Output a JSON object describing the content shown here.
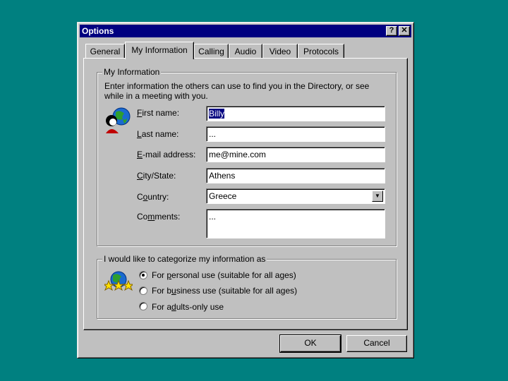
{
  "window": {
    "title": "Options",
    "help_label": "?",
    "close_label": "✕"
  },
  "tabs": [
    {
      "label": "General"
    },
    {
      "label": "My Information",
      "active": true
    },
    {
      "label": "Calling"
    },
    {
      "label": "Audio"
    },
    {
      "label": "Video"
    },
    {
      "label": "Protocols"
    }
  ],
  "info_group": {
    "legend": "My Information",
    "intro_line1": "Enter information the others can use to find you in the Directory, or see",
    "intro_line2": "while in a meeting with you."
  },
  "fields": {
    "first_name": {
      "key": "F",
      "rest": "irst name:",
      "value": "Billy"
    },
    "last_name": {
      "key": "L",
      "rest": "ast name:",
      "value": "..."
    },
    "email": {
      "key": "E",
      "rest": "-mail address:",
      "value": "me@mine.com"
    },
    "city": {
      "key": "C",
      "rest": "ity/State:",
      "value": "Athens"
    },
    "country": {
      "pre": "C",
      "key": "o",
      "rest": "untry:",
      "value": "Greece"
    },
    "comments": {
      "pre": "Co",
      "key": "m",
      "rest": "ments:",
      "value": "..."
    }
  },
  "category_group": {
    "legend": "I would like to categorize my information as",
    "options": [
      {
        "pre": "For ",
        "key": "p",
        "rest": "ersonal use (suitable for all ages)",
        "checked": true
      },
      {
        "pre": "For b",
        "key": "u",
        "rest": "siness use (suitable for all ages)",
        "checked": false
      },
      {
        "pre": "For a",
        "key": "d",
        "rest": "ults-only use",
        "checked": false
      }
    ]
  },
  "buttons": {
    "ok": "OK",
    "cancel": "Cancel"
  },
  "colors": {
    "desktop": "#008080",
    "titlebar": "#000080",
    "face": "#c0c0c0"
  }
}
